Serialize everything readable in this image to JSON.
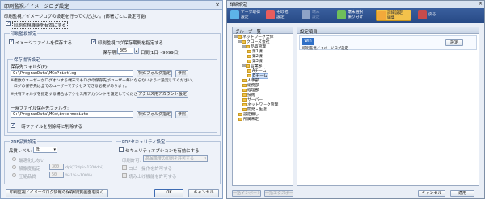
{
  "dialog": {
    "title": "印刷監視／イメージログ設定",
    "close": "×",
    "intro": "印刷監視／イメージログの設定を行ってください。(部署ごとに設定可能)",
    "enable_label": "印刷監視機能を有効にする",
    "group_print": "印刷監視設定",
    "save_image_label": "イメージファイルを保存する",
    "thumb_label": "印刷監視ログ保存期間を指定する",
    "period_label": "保存期間:",
    "period_value": "365",
    "period_unit": "日間(1日〜9999日)",
    "group_save": "保存場所設定",
    "folder_label": "保存先フォルダ(F):",
    "folder_path": "C:\\ProgramData\\MCoPrintlog",
    "special_btn": "特殊フォルダ指定",
    "browse_btn": "参照",
    "note1": "※複数のユーザーがログオンする端末でもログの保存先がユーザー毎にならないように設定してください。",
    "note1b": "ログの保存先は全てのユーザーでアクセスできる必要があります。",
    "note2": "※共有フォルダを指定する場合はアクセス用アカウントを設定してください。",
    "account_btn": "アクセス用アカウント設定",
    "temp_label": "一時ファイル保存先フォルダ:",
    "temp_path": "C:\\ProgramData\\MCo\\intermediate",
    "delete_label": "一時ファイルを削除時に削除する",
    "group_pdf": "PDF品質設定",
    "quality_label": "品質レベル:",
    "quality_value": "低",
    "opt1": "最適化しない",
    "opt2": "解像度指定",
    "opt3": "圧縮品質",
    "opt2_val": "300",
    "opt2_unit": "dpi(72dpi〜1200dpi)",
    "opt3_val": "50",
    "opt3_unit": "%(1%〜100%)",
    "group_sec": "PDFセキュリティ設定",
    "sec_label": "セキュリティオプションを有効にする",
    "sec_print": "印刷許可:",
    "sec_print_val": "高解像度の印刷を許可する",
    "sec_copy": "コピー操作を許可する",
    "sec_read": "読み上げ機能を許可する",
    "footer_btn": "印刷監視／イメージログ情報の保存/閲覧画面を開く",
    "ok": "OK",
    "cancel": "キャンセル"
  },
  "window": {
    "title": "詳細設定",
    "close": "×",
    "toolbar": [
      {
        "label": "データ取得",
        "label2": "設定",
        "color": "#5db3e8"
      },
      {
        "label": "その他",
        "label2": "設定",
        "color": "#e85d5d"
      },
      {
        "label": "端末",
        "label2": "設定",
        "color": "#8ea3c7"
      },
      {
        "label": "端末選択",
        "label2": "振り分け",
        "color": "#6fbf5a"
      },
      {
        "label": "詳細設定",
        "label2": "編集",
        "color": "#f2a93b"
      },
      {
        "label": "戻る",
        "label2": "",
        "color": "#c84b4b"
      }
    ],
    "left_header": "グループ一覧",
    "tree": [
      "ネットワーク全体",
      "クローズ会社",
      "品質管理",
      "第1課",
      "第2課",
      "第3課",
      "営業部",
      "Aチーム",
      "Bチーム",
      "人事部",
      "総務部",
      "経理部",
      "技術",
      "サーバー",
      "ネットワーク管理",
      "開発・生産",
      "設定無し",
      "所属未定"
    ],
    "right_header": "設定項目",
    "row_icon": "Win",
    "row_text": "印刷監視／イメージログ設定",
    "row_btn": "設定",
    "import_btn": "一括インポート",
    "export_btn": "一括エクスポート",
    "cancel_btn": "キャンセル",
    "apply_btn": "適用"
  }
}
